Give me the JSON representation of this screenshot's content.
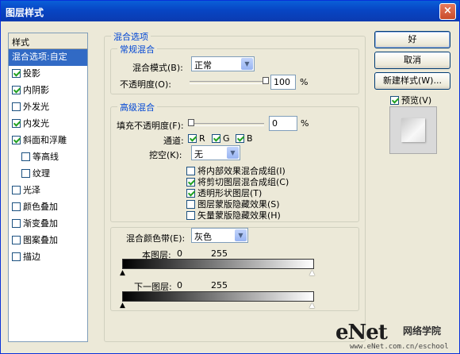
{
  "window": {
    "title": "图层样式",
    "close": "×"
  },
  "styles": {
    "header": "样式",
    "items": [
      {
        "label": "混合选项:自定",
        "checked": null,
        "selected": true
      },
      {
        "label": "投影",
        "checked": true
      },
      {
        "label": "内阴影",
        "checked": true
      },
      {
        "label": "外发光",
        "checked": false
      },
      {
        "label": "内发光",
        "checked": true
      },
      {
        "label": "斜面和浮雕",
        "checked": true
      },
      {
        "label": "等高线",
        "checked": false,
        "sub": true
      },
      {
        "label": "纹理",
        "checked": false,
        "sub": true
      },
      {
        "label": "光泽",
        "checked": false
      },
      {
        "label": "颜色叠加",
        "checked": false
      },
      {
        "label": "渐变叠加",
        "checked": false
      },
      {
        "label": "图案叠加",
        "checked": false
      },
      {
        "label": "描边",
        "checked": false
      }
    ]
  },
  "blend_options": {
    "title": "混合选项",
    "general": {
      "title": "常规混合",
      "mode_label": "混合模式(B):",
      "mode_value": "正常",
      "opacity_label": "不透明度(O):",
      "opacity_value": "100",
      "opacity_level": 1.0,
      "percent": "%"
    },
    "advanced": {
      "title": "高级混合",
      "fill_label": "填充不透明度(F):",
      "fill_value": "0",
      "fill_level": 0.0,
      "percent": "%",
      "channels_label": "通道:",
      "channel_r": "R",
      "channel_g": "G",
      "channel_b": "B",
      "knockout_label": "挖空(K):",
      "knockout_value": "无",
      "options": [
        {
          "label": "将内部效果混合成组(I)",
          "checked": false
        },
        {
          "label": "将剪切图层混合成组(C)",
          "checked": true
        },
        {
          "label": "透明形状图层(T)",
          "checked": true
        },
        {
          "label": "图层蒙版隐藏效果(S)",
          "checked": false
        },
        {
          "label": "矢量蒙版隐藏效果(H)",
          "checked": false
        }
      ]
    },
    "blend_if": {
      "label": "混合颜色带(E):",
      "value": "灰色",
      "this_layer_label": "本图层:",
      "this_layer_min": "0",
      "this_layer_max": "255",
      "underlying_label": "下一图层:",
      "underlying_min": "0",
      "underlying_max": "255"
    }
  },
  "buttons": {
    "ok": "好",
    "cancel": "取消",
    "new_style": "新建样式(W)...",
    "preview_label": "预览(V)",
    "preview_checked": true
  },
  "watermark": {
    "logo": "eNet",
    "cn": "网络学院",
    "url": "www.eNet.com.cn/eschool"
  }
}
